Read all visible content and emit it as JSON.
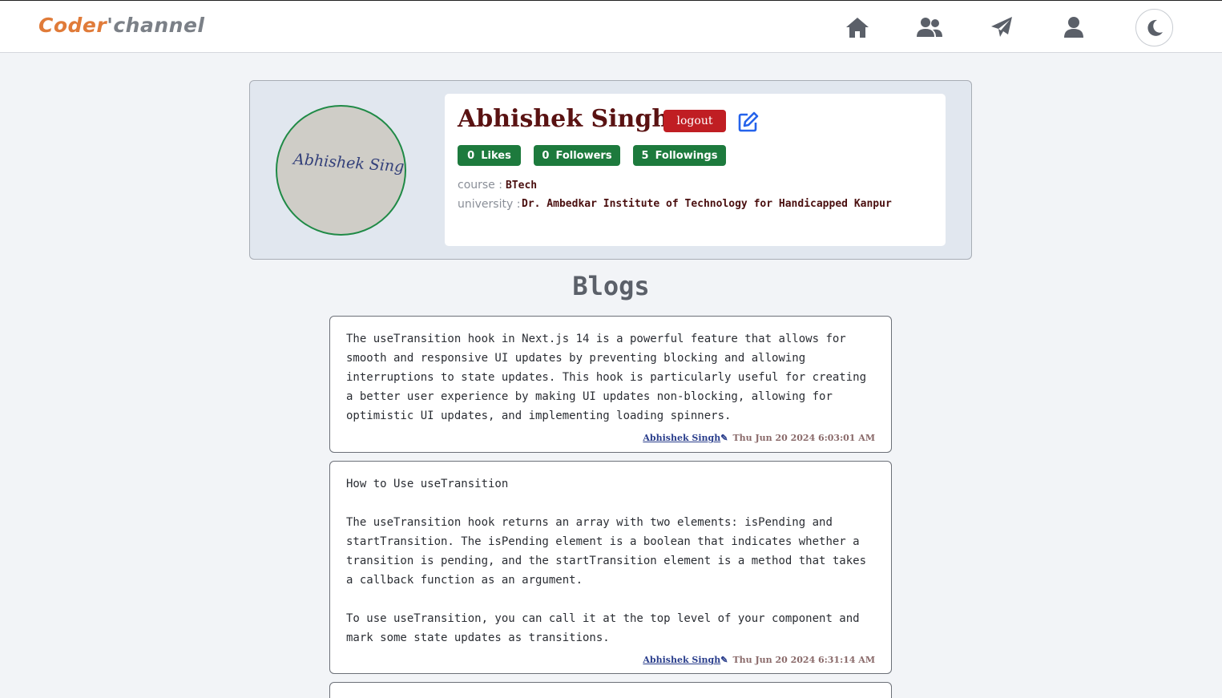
{
  "header": {
    "logo_part1": "Coder",
    "logo_part2": "'channel",
    "nav": [
      {
        "name": "home",
        "icon": "home-icon"
      },
      {
        "name": "users",
        "icon": "users-icon"
      },
      {
        "name": "send",
        "icon": "paper-plane-icon"
      },
      {
        "name": "profile",
        "icon": "user-icon"
      }
    ],
    "theme_icon": "moon-icon"
  },
  "profile": {
    "avatar_signature": "Abhishek Singh",
    "name": "Abhishek Singh",
    "logout_label": "logout",
    "edit_icon": "edit-icon",
    "stats": {
      "likes_count": "0",
      "likes_label": "Likes",
      "followers_count": "0",
      "followers_label": "Followers",
      "followings_count": "5",
      "followings_label": "Followings"
    },
    "course_label": "course :",
    "course_value": "BTech",
    "university_label": "university :",
    "university_value": "Dr. Ambedkar Institute of Technology for Handicapped Kanpur"
  },
  "blogs_title": "Blogs",
  "blogs": [
    {
      "text": "The useTransition hook in Next.js 14 is a powerful feature that allows for smooth and responsive UI updates by preventing blocking and allowing interruptions to state updates. This hook is particularly useful for creating a better user experience by making UI updates non-blocking, allowing for optimistic UI updates, and implementing loading spinners.",
      "author": "Abhishek Singh",
      "date": "Thu Jun 20 2024 6:03:01 AM"
    },
    {
      "text": "How to Use useTransition\n\nThe useTransition hook returns an array with two elements: isPending and startTransition. The isPending element is a boolean that indicates whether a transition is pending, and the startTransition element is a method that takes a callback function as an argument.\n\nTo use useTransition, you can call it at the top level of your component and mark some state updates as transitions.",
      "author": "Abhishek Singh",
      "date": "Thu Jun 20 2024 6:31:14 AM"
    }
  ],
  "colors": {
    "accent_green": "#1d7a3d",
    "logout_red": "#c01e23",
    "name_color": "#5a1212",
    "logo_orange": "#e07b39"
  }
}
